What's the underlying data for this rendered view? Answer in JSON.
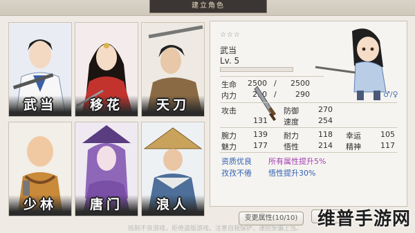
{
  "header": {
    "title": "建立角色"
  },
  "cards": [
    {
      "name": "武当",
      "color": "#3b5fa8"
    },
    {
      "name": "移花",
      "color": "#c2332e"
    },
    {
      "name": "天刀",
      "color": "#8a6a45"
    },
    {
      "name": "少林",
      "color": "#c98a3a"
    },
    {
      "name": "唐门",
      "color": "#7a4fa6"
    },
    {
      "name": "浪人",
      "color": "#4d6f99"
    }
  ],
  "info": {
    "stars": "☆☆☆",
    "sect": "武当",
    "level": "Lv. 5",
    "exp_fill": 0.0,
    "hp_label": "生命",
    "hp_cur": "2500",
    "hp_sep": "/",
    "hp_max": "2500",
    "mp_label": "内力",
    "mp_cur": "290",
    "mp_sep": "/",
    "mp_max": "290",
    "gender": "♂/♀",
    "attack_label": "攻击",
    "attack": "131",
    "defense_label": "防御",
    "defense": "270",
    "speed_label": "速度",
    "speed": "254",
    "wrist_label": "腕力",
    "wrist": "139",
    "endure_label": "耐力",
    "endure": "118",
    "luck_label": "幸运",
    "luck": "105",
    "charm_label": "魅力",
    "charm": "177",
    "wisdom_label": "悟性",
    "wisdom": "214",
    "spirit_label": "精神",
    "spirit": "117",
    "traits": [
      {
        "name": "资质优良",
        "effect": "所有属性提升5%"
      },
      {
        "name": "孜孜不倦",
        "effect": "悟性提升30%"
      }
    ]
  },
  "buttons": {
    "change_attr": "变更属性(10/10)"
  },
  "footer": {
    "notice": "抵制不良游戏，拒绝盗版游戏。注意自我保护，谨防受骗上当。"
  },
  "watermark": "维普手游网"
}
